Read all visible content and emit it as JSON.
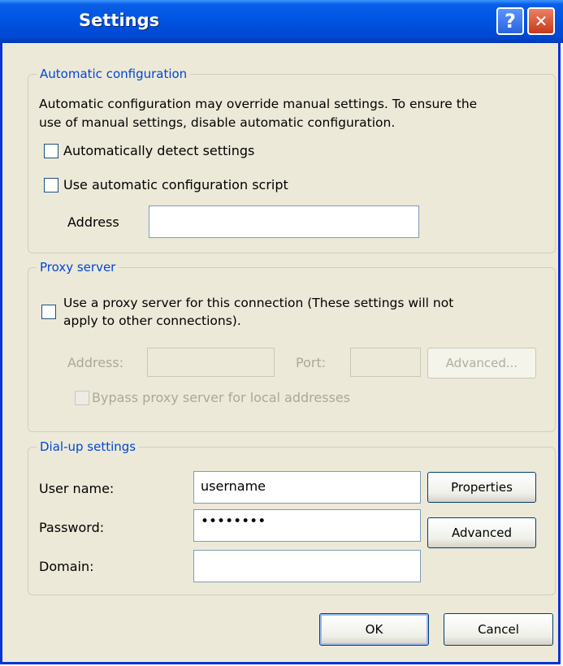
{
  "window": {
    "title": "Settings",
    "help_icon": "?",
    "close_icon": "✕"
  },
  "auto_config": {
    "legend": "Automatic configuration",
    "description_line1": "Automatic configuration may override manual settings.  To ensure the",
    "description_line2": "use of manual settings, disable automatic configuration.",
    "detect_label": "Automatically detect settings",
    "detect_checked": false,
    "script_label": "Use automatic configuration script",
    "script_checked": false,
    "address_label": "Address",
    "address_value": ""
  },
  "proxy": {
    "legend": "Proxy server",
    "use_proxy_line1": "Use a proxy server for this connection (These settings will not",
    "use_proxy_line2": "apply to other connections).",
    "use_proxy_checked": false,
    "address_label": "Address:",
    "address_value": "",
    "port_label": "Port:",
    "port_value": "",
    "advanced_label": "Advanced...",
    "bypass_label": "Bypass proxy server for local addresses",
    "bypass_checked": false
  },
  "dialup": {
    "legend": "Dial-up settings",
    "username_label": "User name:",
    "username_value": "username",
    "password_label": "Password:",
    "password_value": "••••••••",
    "domain_label": "Domain:",
    "domain_value": "",
    "properties_label": "Properties",
    "advanced_label": "Advanced"
  },
  "buttons": {
    "ok": "OK",
    "cancel": "Cancel"
  }
}
